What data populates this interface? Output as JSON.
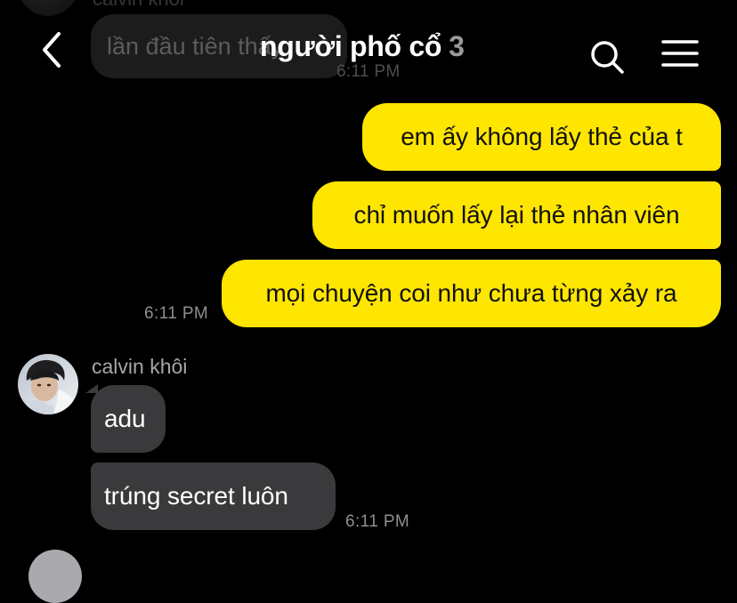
{
  "background": "#000000",
  "colors": {
    "outgoing_bubble": "#ffe600",
    "incoming_bubble": "#3a3a3c",
    "timestamp": "#8e8e8e",
    "sender_name": "#a6a6a6"
  },
  "header": {
    "back_icon": "chevron-left-icon",
    "title": "người phố cổ",
    "member_count": "3",
    "search_icon": "search-icon",
    "menu_icon": "hamburger-menu-icon"
  },
  "faded_message": {
    "sender": "calvin khôi",
    "text": "lần đầu tiên thấy",
    "time": "6:11 PM"
  },
  "outgoing": {
    "messages": [
      "em ấy không lấy thẻ của t",
      "chỉ muốn lấy lại thẻ nhân viên",
      "mọi chuyện coi như chưa từng xảy ra"
    ],
    "time": "6:11 PM"
  },
  "incoming": {
    "sender": "calvin khôi",
    "messages": [
      "adu",
      "trúng secret luôn"
    ],
    "time": "6:11 PM"
  }
}
